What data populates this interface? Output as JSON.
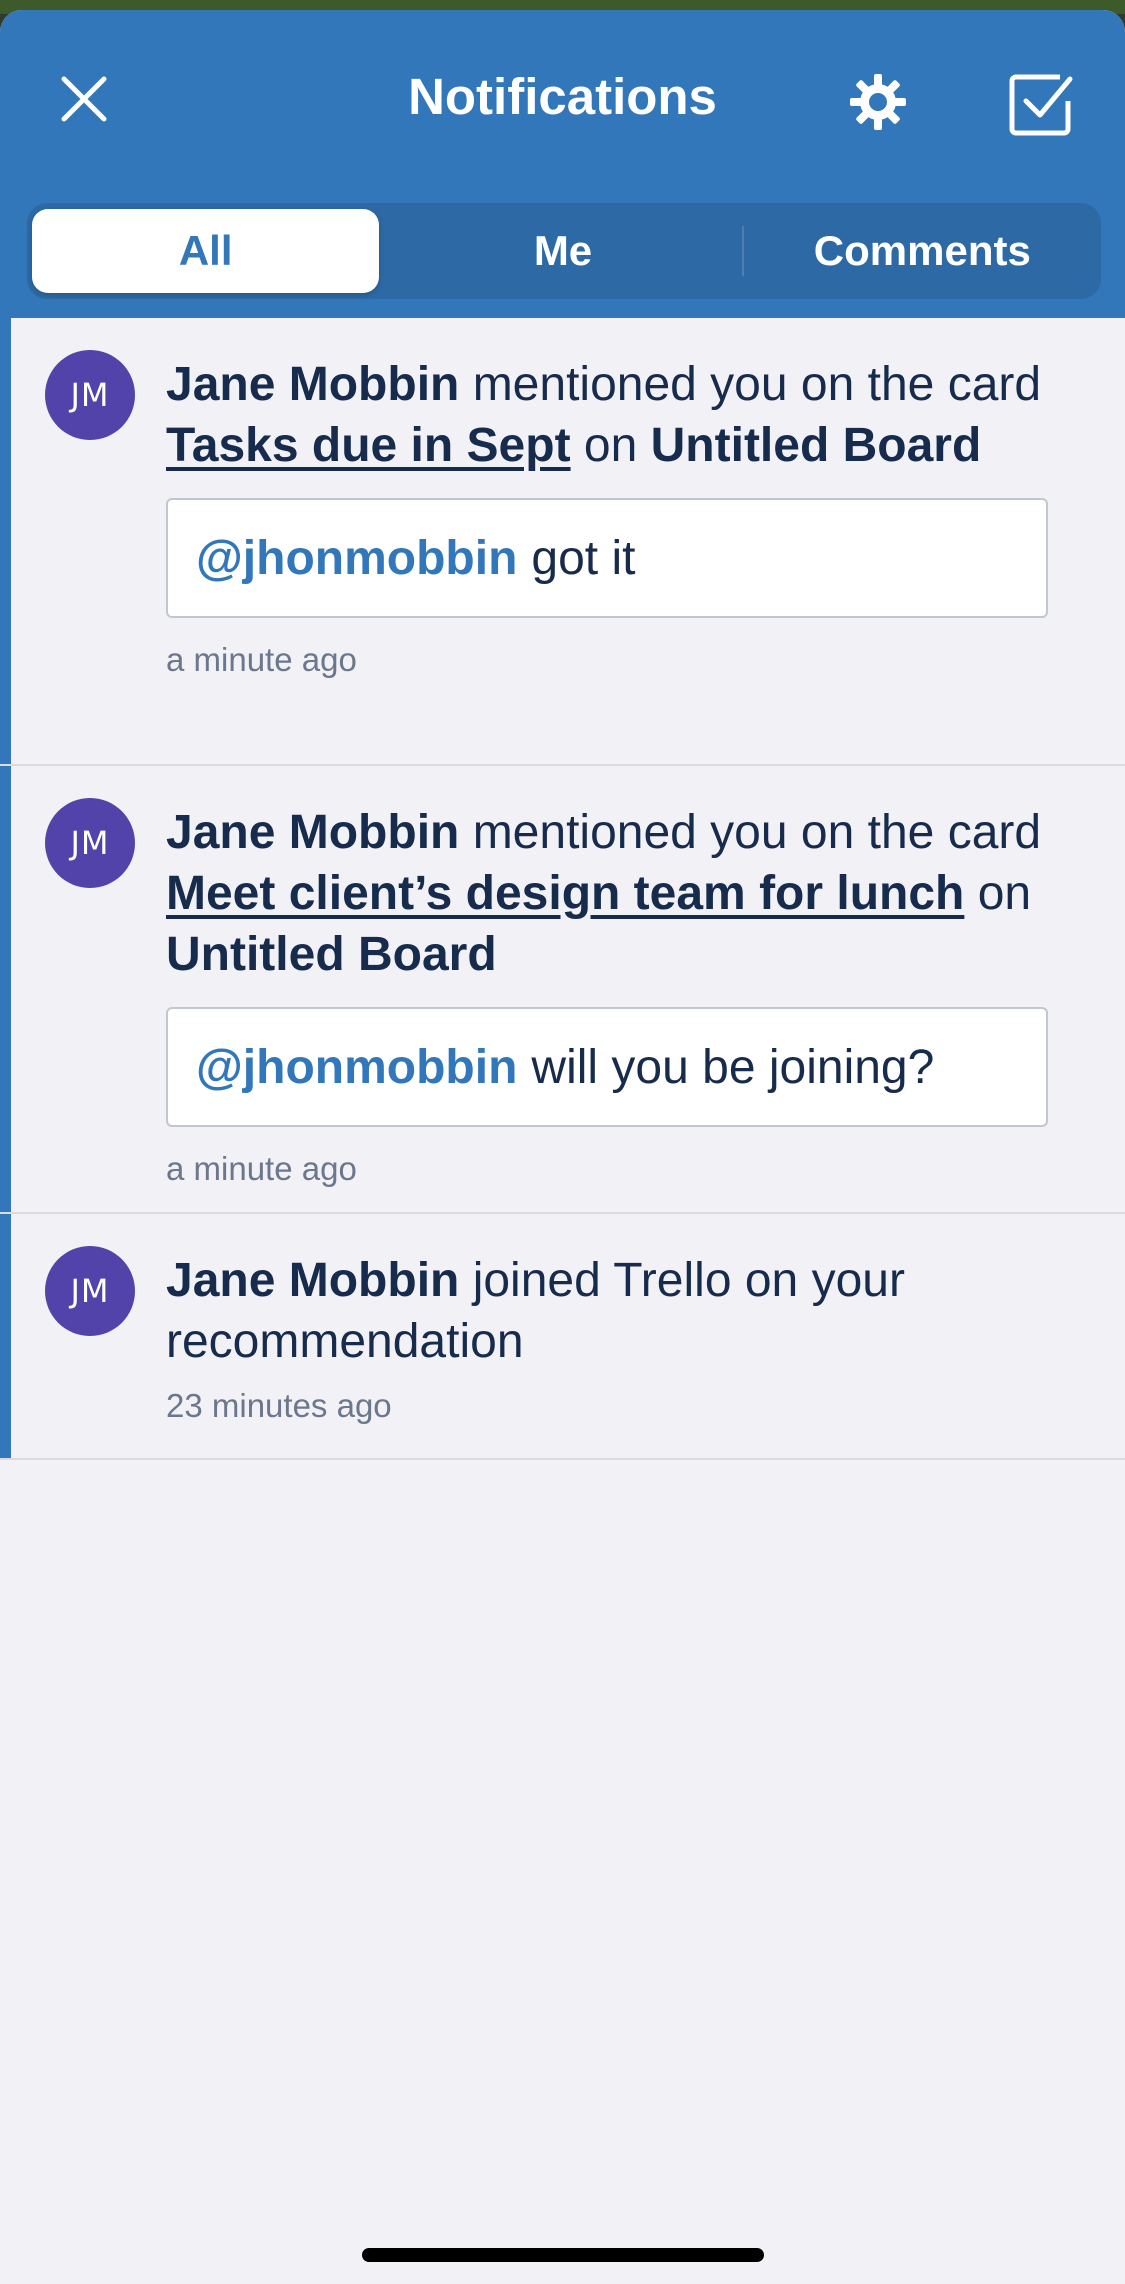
{
  "header": {
    "title": "Notifications",
    "close_icon": "close-icon",
    "settings_icon": "gear-icon",
    "mark_read_icon": "checkbox-check-icon"
  },
  "tabs": [
    {
      "label": "All",
      "active": true
    },
    {
      "label": "Me",
      "active": false
    },
    {
      "label": "Comments",
      "active": false
    }
  ],
  "notifications": [
    {
      "avatar": "JM",
      "actor": "Jane Mobbin",
      "action": "mentioned you on the card",
      "card": "Tasks due in Sept",
      "on": "on",
      "board": "Untitled Board",
      "mention": "@jhonmobbin",
      "comment": "got it",
      "time": "a minute ago"
    },
    {
      "avatar": "JM",
      "actor": "Jane Mobbin",
      "action": "mentioned you on the card",
      "card": "Meet client’s design team for lunch",
      "on": "on",
      "board": "Untitled Board",
      "mention": "@jhonmobbin",
      "comment": "will you be joining?",
      "time": "a minute ago"
    },
    {
      "avatar": "JM",
      "actor": "Jane Mobbin",
      "action": "joined Trello on your recommendation",
      "time": "23 minutes ago"
    }
  ],
  "colors": {
    "header_blue": "#3277b9",
    "tab_track": "#2d6aa5",
    "avatar_purple": "#5243aa",
    "text_dark": "#172b4d",
    "text_muted": "#6b778c"
  }
}
